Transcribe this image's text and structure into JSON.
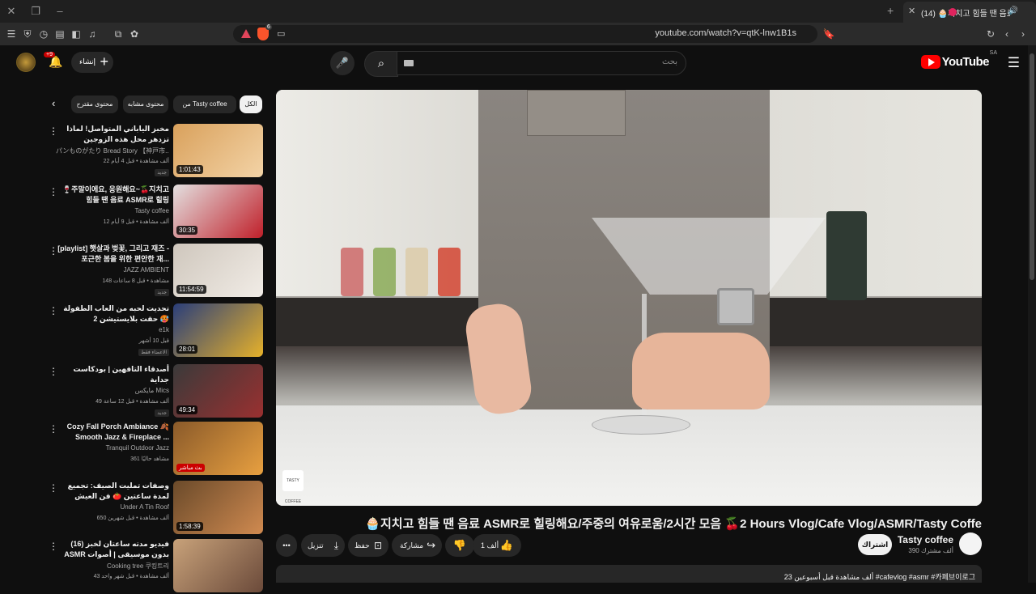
{
  "browser": {
    "active_tab_title": "(14) 🧁지치고 힘들 땐 음료 A",
    "url": "youtube.com/watch?v=qtK-lnw1B1s",
    "shield_badge": "6"
  },
  "header": {
    "logo_text": "YouTube",
    "country_code": "SA",
    "search_placeholder": "بحث",
    "create_label": "إنشاء",
    "notifications_count": "+9"
  },
  "video": {
    "title": "🧁지치고 힘들 땐 음료 ASMR로 힐링해요/주중의 여유로움/2시간 모음 🍒2 Hours Vlog/Cafe Vlog/ASMR/Tasty Coffe",
    "watermark": "TASTY COFFEE",
    "channel_name": "Tasty coffee",
    "subscribers": "390 ألف مشترك",
    "subscribe_label": "اشتراك",
    "like_count": "1 ألف",
    "share_label": "مشاركة",
    "save_label": "حفظ",
    "download_label": "تنزيل",
    "description": "23 ألف مشاهدة قبل أسبوعين  #cafevlog #asmr #카페브이로그"
  },
  "chips": [
    {
      "label": "الكل",
      "selected": true
    },
    {
      "label": "من Tasty coffee",
      "selected": false
    },
    {
      "label": "محتوى مشابه",
      "selected": false
    },
    {
      "label": "محتوى مقترح",
      "selected": false
    }
  ],
  "recommendations": [
    {
      "title": "مخبز الياباني المتواصل! لماذا تزدهر محل هذه الزوجين المحليين من الساعة 2 صباحًا لمدة ...",
      "channel": "パンものがたり Bread Story 【神戸市...",
      "meta": "22 ألف مشاهدة • قبل 4 أيام",
      "badge": "جديد",
      "duration": "1:01:43",
      "colors": [
        "#d9a15c",
        "#f3d3a6"
      ]
    },
    {
      "title": "🍷주말이에요, 응원해요~🍒지치고 힘들 땐 음료 ASMR로 힐링",
      "channel": "Tasty coffee",
      "meta": "12 ألف مشاهدة • قبل 9 أيام",
      "badge": "",
      "duration": "30:35",
      "colors": [
        "#e3e0e0",
        "#c0202a"
      ]
    },
    {
      "title": "[playlist] 햇살과 벚꽃, 그리고 재즈 - 포근한 봄을 위한 편안한 재...",
      "channel": "JAZZ AMBIENT",
      "meta": "148 مشاهدة • قبل 8 ساعات",
      "badge": "جديد",
      "duration": "11:54:59",
      "colors": [
        "#cfc7bd",
        "#f1ece6"
      ]
    },
    {
      "title": "تحديت لحبه من العاب الطفولة حقت بلايستيشن 2 🥵",
      "channel": "e1k",
      "meta": "قبل 10 أشهر",
      "badge": "الاعضاء فقط",
      "duration": "28:01",
      "colors": [
        "#2a3e7a",
        "#e6b12a"
      ]
    },
    {
      "title": "أصدقاء التافهين | بودكاست جداية",
      "channel": "مايكس Mics",
      "meta": "49 ألف مشاهدة • قبل 12 ساعة",
      "badge": "جديد",
      "duration": "49:34",
      "colors": [
        "#3a3a3a",
        "#9a3030"
      ]
    },
    {
      "title": "Cozy Fall Porch Ambiance 🍂 Smooth Jazz & Fireplace ...",
      "channel": "Tranquil Outdoor Jazz",
      "meta": "361 مشاهد حاليًا",
      "badge": "",
      "duration": "بث مباشر",
      "colors": [
        "#8a5a2a",
        "#e8a040"
      ]
    },
    {
      "title": "وصفات تمليت الصيف: تجميع لمدة ساعتين 🍅 فن العيش البطيء في الريف",
      "channel": "Under A Tin Roof",
      "meta": "650 ألف مشاهدة • قبل شهرين",
      "badge": "",
      "duration": "1:58:39",
      "colors": [
        "#6a4a2a",
        "#d08a50"
      ]
    },
    {
      "title": "(16) فيديو مدته ساعتان لخبز ASMR بدون موسيقى | أصوات نوم مريحة | كعك كعكة ...",
      "channel": "Cooking tree 쿠킹트리",
      "meta": "43 ألف مشاهدة • قبل شهر واحد",
      "badge": "",
      "duration": "",
      "colors": [
        "#c8a27a",
        "#6b4a3a"
      ]
    }
  ]
}
